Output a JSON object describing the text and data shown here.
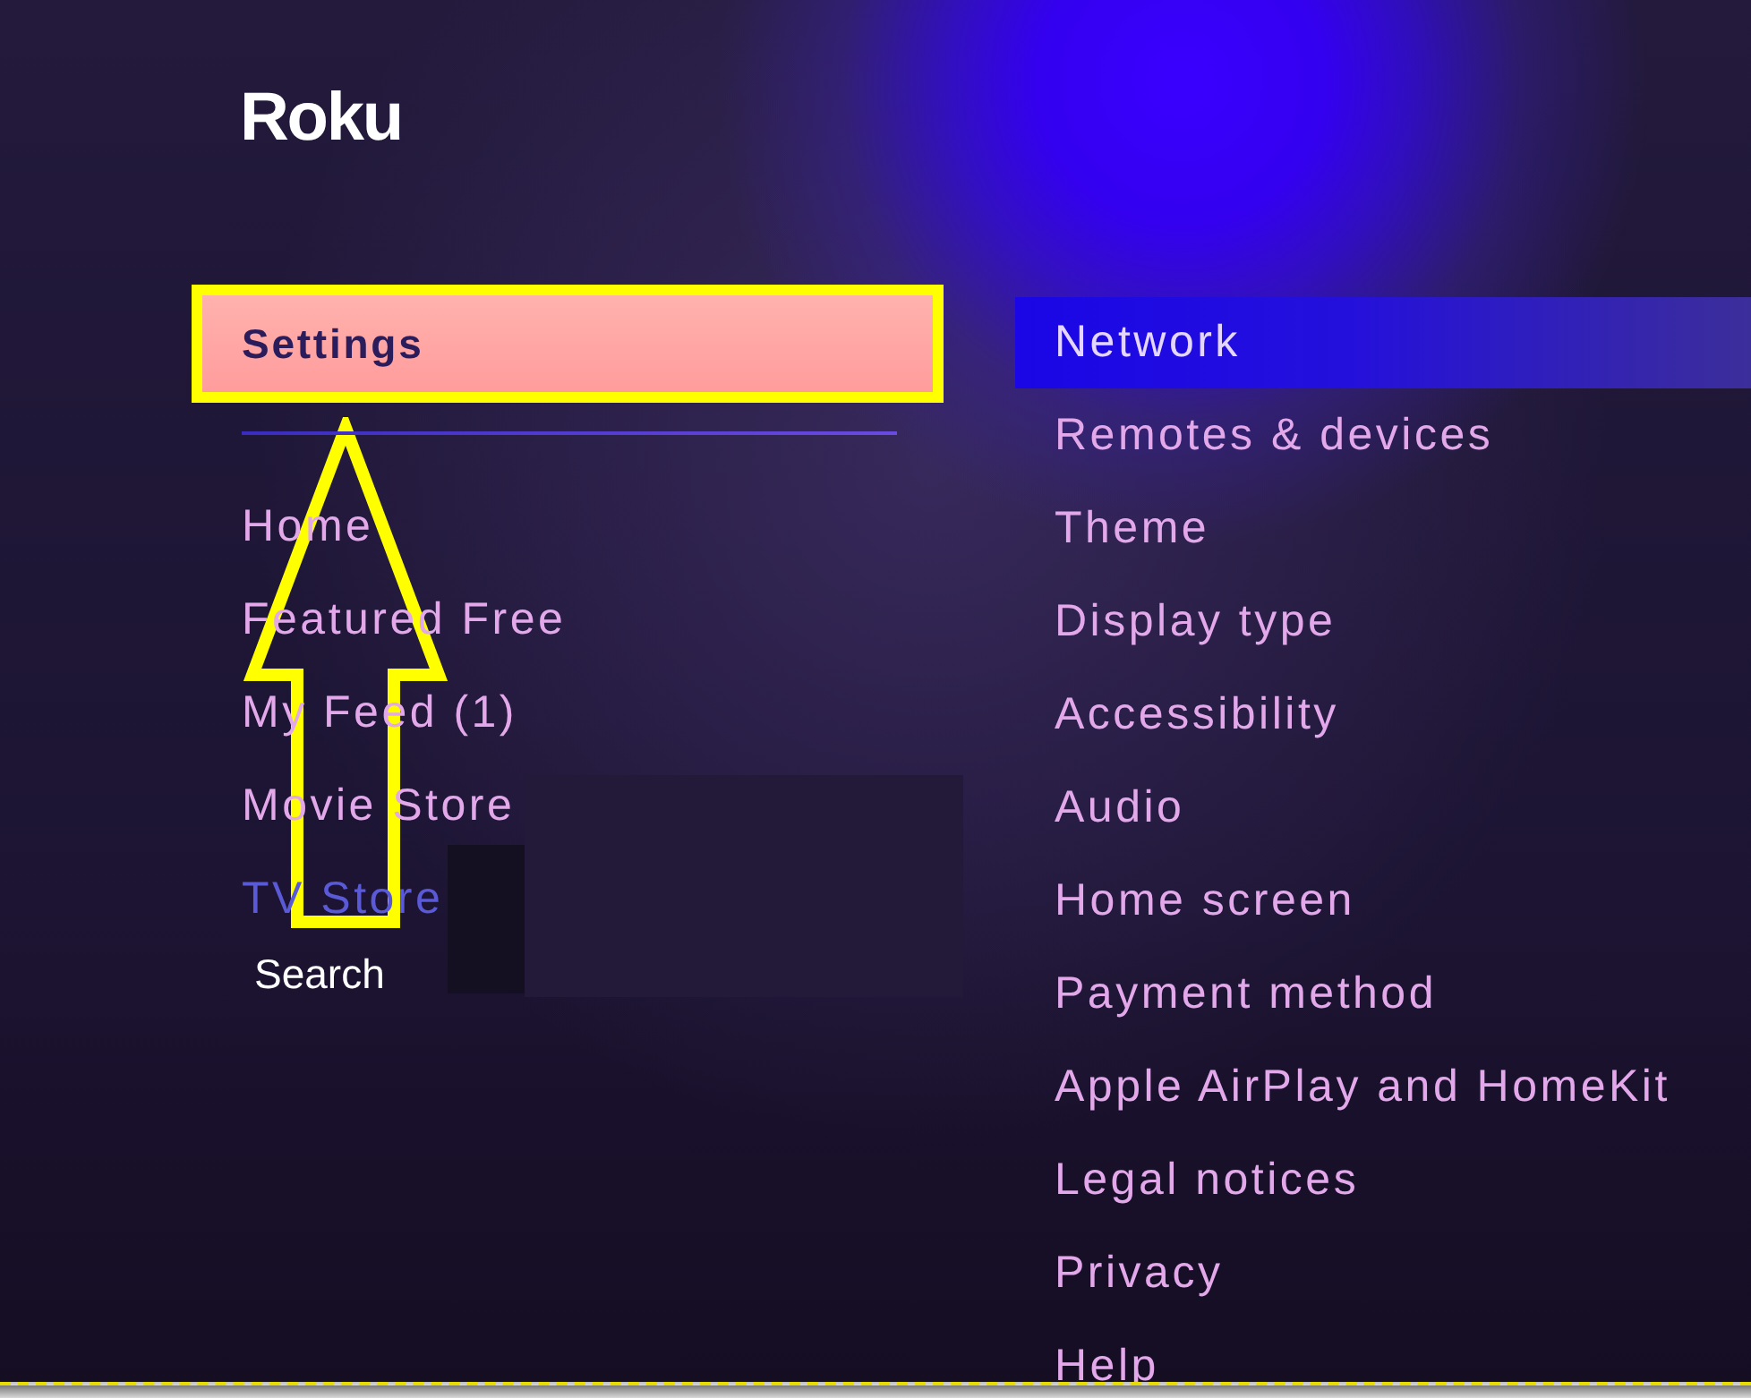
{
  "logo": {
    "text": "Roku"
  },
  "sidebar": {
    "items": [
      {
        "label": "Settings",
        "selected": true,
        "annotated": true,
        "faded": false
      },
      {
        "label": "Home",
        "selected": false,
        "annotated": false,
        "faded": false
      },
      {
        "label": "Featured Free",
        "selected": false,
        "annotated": false,
        "faded": false
      },
      {
        "label": "My Feed (1)",
        "selected": false,
        "annotated": false,
        "faded": false
      },
      {
        "label": "Movie Store",
        "selected": false,
        "annotated": false,
        "faded": false
      },
      {
        "label": "TV Store",
        "selected": false,
        "annotated": false,
        "faded": true
      }
    ]
  },
  "overlay": {
    "label": "Search"
  },
  "settings_menu": {
    "items": [
      {
        "label": "Network",
        "selected": true
      },
      {
        "label": "Remotes & devices",
        "selected": false
      },
      {
        "label": "Theme",
        "selected": false
      },
      {
        "label": "Display type",
        "selected": false
      },
      {
        "label": "Accessibility",
        "selected": false
      },
      {
        "label": "Audio",
        "selected": false
      },
      {
        "label": "Home screen",
        "selected": false
      },
      {
        "label": "Payment method",
        "selected": false
      },
      {
        "label": "Apple AirPlay and HomeKit",
        "selected": false
      },
      {
        "label": "Legal notices",
        "selected": false
      },
      {
        "label": "Privacy",
        "selected": false
      },
      {
        "label": "Help",
        "selected": false
      }
    ]
  },
  "annotations": [
    {
      "kind": "arrow"
    }
  ]
}
